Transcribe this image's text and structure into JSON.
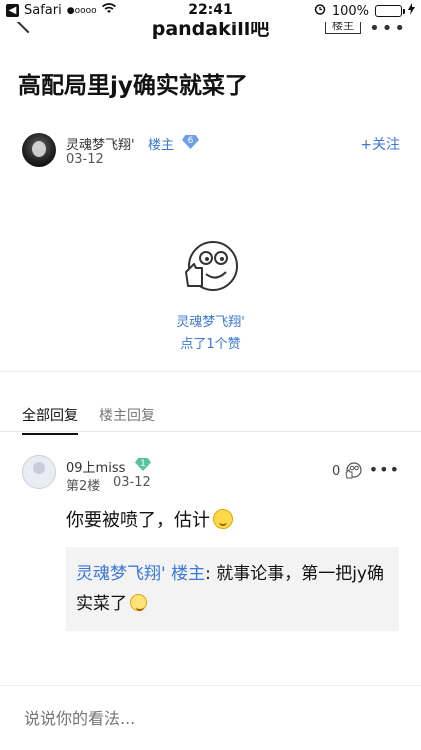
{
  "status": {
    "carrier": "Safari",
    "signal": "●oooo",
    "time": "22:41",
    "battery": "100%"
  },
  "nav": {
    "title": "pandakill吧",
    "owner_only_label": "楼主",
    "more_label": "•••"
  },
  "post": {
    "title": "高配局里jy确实就菜了",
    "author_name": "灵魂梦飞翔'",
    "author_role": "楼主",
    "author_level": "6",
    "date": "03-12",
    "follow_label": "+关注",
    "liker_name": "灵魂梦飞翔'",
    "like_count_text": "点了1个赞"
  },
  "tabs": {
    "all": "全部回复",
    "owner": "楼主回复"
  },
  "reply": {
    "user": "09上miss",
    "level": "1",
    "floor": "第2楼",
    "date": "03-12",
    "likes": "0",
    "more": "•••",
    "content": "你要被喷了，估计",
    "quote_author": "灵魂梦飞翔' 楼主",
    "quote_text": ": 就事论事，第一把jy确实菜了"
  },
  "input": {
    "placeholder": "说说你的看法..."
  },
  "colors": {
    "accent": "#3b78d8",
    "battery": "#3ecf3e"
  }
}
